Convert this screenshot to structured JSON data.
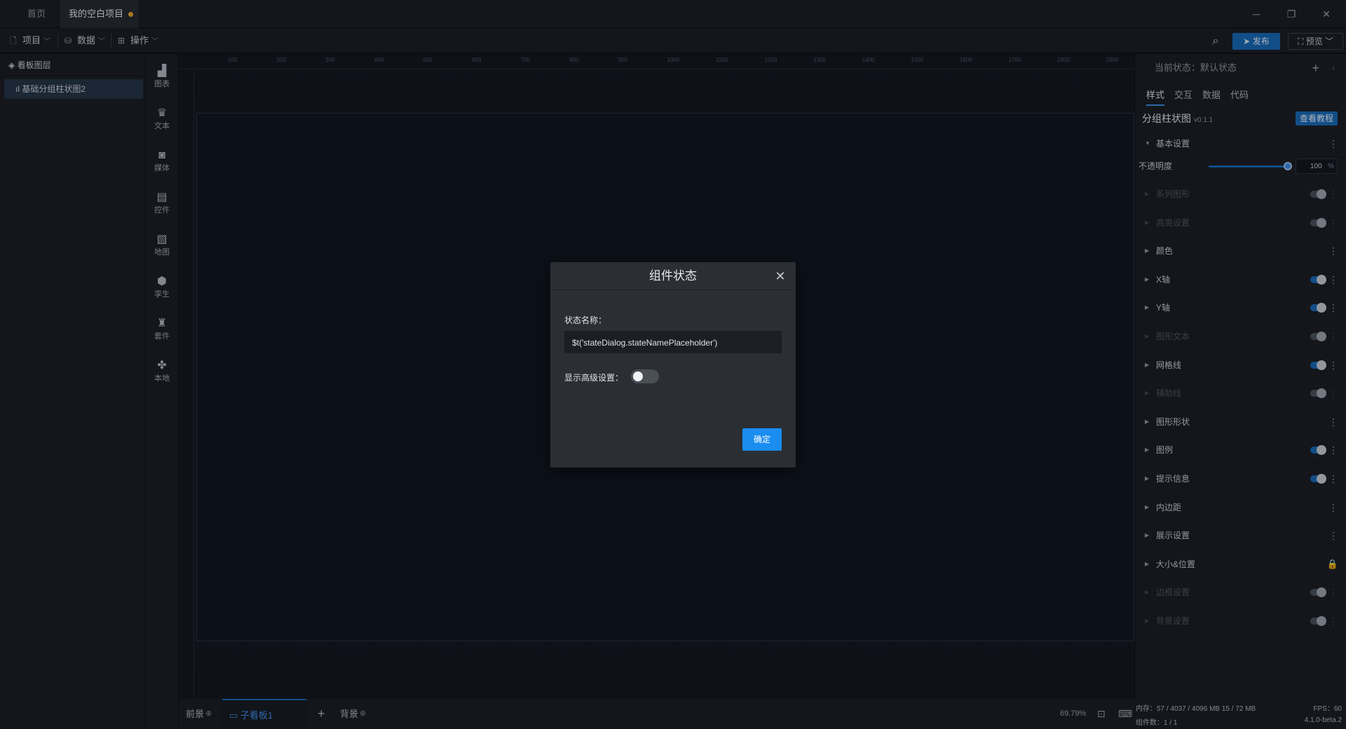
{
  "tabs": {
    "home": "首页",
    "project": "我的空白项目"
  },
  "window": {
    "minimize": "─",
    "restore": "❐",
    "close": "✕"
  },
  "menus": {
    "project": "项目",
    "data": "数据",
    "operation": "操作"
  },
  "actions": {
    "publish": "发布",
    "preview": "预览"
  },
  "layers": {
    "title": "看板图层",
    "items": [
      "基础分组柱状图2"
    ]
  },
  "toolbox": [
    {
      "label": "图表",
      "icon": "bar-chart-icon"
    },
    {
      "label": "文本",
      "icon": "text-icon"
    },
    {
      "label": "媒体",
      "icon": "media-icon"
    },
    {
      "label": "控件",
      "icon": "control-icon"
    },
    {
      "label": "地图",
      "icon": "map-icon"
    },
    {
      "label": "孪生",
      "icon": "twin-cube-icon"
    },
    {
      "label": "套件",
      "icon": "kit-icon"
    },
    {
      "label": "本地",
      "icon": "local-icon"
    }
  ],
  "ruler": {
    "h": [
      "100",
      "200",
      "300",
      "400",
      "500",
      "600",
      "700",
      "800",
      "900",
      "1000",
      "1100",
      "1200",
      "1300",
      "1400",
      "1500",
      "1600",
      "1700",
      "1800",
      "1900"
    ]
  },
  "bottom": {
    "foreground": "前景",
    "sub_board": "子看板1",
    "add": "+",
    "background": "背景",
    "zoom": "69.79%"
  },
  "panel": {
    "current_state": "当前状态：默认状态",
    "tabs": [
      "样式",
      "交互",
      "数据",
      "代码"
    ],
    "component_name": "分组柱状图",
    "version": "v0.1.1",
    "tutorial": "查看教程",
    "opacity_label": "不透明度",
    "opacity_value": "100",
    "opacity_unit": "%",
    "sections": [
      {
        "label": "基本设置",
        "state": "open"
      },
      {
        "label": "系列图形",
        "state": "off"
      },
      {
        "label": "高亮设置",
        "state": "off"
      },
      {
        "label": "颜色",
        "state": "normal"
      },
      {
        "label": "X轴",
        "state": "on"
      },
      {
        "label": "Y轴",
        "state": "on"
      },
      {
        "label": "图形文本",
        "state": "off"
      },
      {
        "label": "网格线",
        "state": "on"
      },
      {
        "label": "辅助线",
        "state": "off"
      },
      {
        "label": "图形形状",
        "state": "normal"
      },
      {
        "label": "图例",
        "state": "on"
      },
      {
        "label": "提示信息",
        "state": "on"
      },
      {
        "label": "内边距",
        "state": "normal"
      },
      {
        "label": "展示设置",
        "state": "normal"
      },
      {
        "label": "大小&位置",
        "state": "lock"
      },
      {
        "label": "边框设置",
        "state": "off"
      },
      {
        "label": "背景设置",
        "state": "off"
      }
    ]
  },
  "status": {
    "memory": "内存：57 / 4037 / 4096 MB  15 / 72 MB",
    "components": "组件数：1 / 1",
    "fps": "FPS：60",
    "version": "4.1.0-beta.2"
  },
  "modal": {
    "title": "组件状态",
    "name_label": "状态名称：",
    "name_value": "$t('stateDialog.stateNamePlaceholder')",
    "advanced_label": "显示高级设置：",
    "confirm": "确定"
  },
  "colors": {
    "accent": "#1767b5",
    "confirm": "#1a8df0",
    "dot": "#e0a030"
  }
}
